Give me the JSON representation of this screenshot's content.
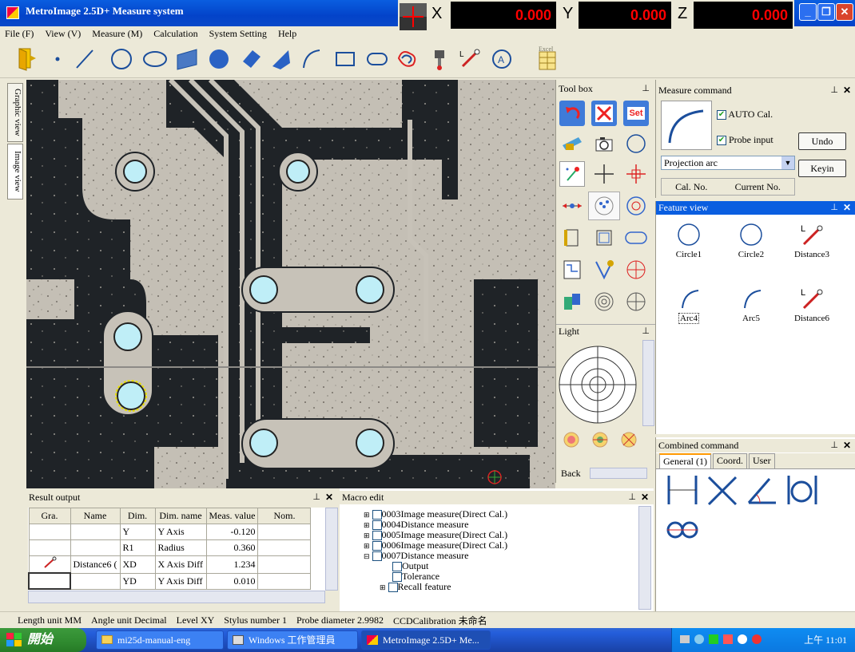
{
  "window": {
    "title": "MetroImage 2.5D+ Measure system"
  },
  "menu": [
    "File (F)",
    "View (V)",
    "Measure (M)",
    "Calculation",
    "System Setting",
    "Help"
  ],
  "coords": {
    "x_label": "X",
    "y_label": "Y",
    "z_label": "Z",
    "x_value": "0.000",
    "y_value": "0.000",
    "z_value": "0.000"
  },
  "toolbar_icons": [
    "exit-icon",
    "point-icon",
    "line-icon",
    "circle-icon",
    "ellipse-icon",
    "plane-icon",
    "sphere-icon",
    "cylinder-icon",
    "cone-icon",
    "arc-icon",
    "rectangle-icon",
    "slot-icon",
    "curve-icon",
    "probe-icon",
    "distance-icon",
    "angle-icon",
    "excel-icon"
  ],
  "toolbar": {
    "excel_label": "Excel"
  },
  "left_tabs": [
    "Graphic view",
    "Image view"
  ],
  "toolbox": {
    "title": "Tool box",
    "set_label": "Set"
  },
  "light": {
    "title": "Light",
    "back_label": "Back"
  },
  "measure_command": {
    "title": "Measure command",
    "auto_cal": "AUTO Cal.",
    "probe_input": "Probe input",
    "undo": "Undo",
    "keyin": "Keyin",
    "select_value": "Projection arc",
    "col_cal_no": "Cal. No.",
    "col_current_no": "Current No."
  },
  "feature_view": {
    "title": "Feature view",
    "items": [
      {
        "name": "Circle1",
        "icon": "circle-icon"
      },
      {
        "name": "Circle2",
        "icon": "circle-icon"
      },
      {
        "name": "Distance3",
        "icon": "distance-icon"
      },
      {
        "name": "Arc4",
        "icon": "arc-icon"
      },
      {
        "name": "Arc5",
        "icon": "arc-icon"
      },
      {
        "name": "Distance6",
        "icon": "distance-icon"
      }
    ]
  },
  "combined_command": {
    "title": "Combined command",
    "tabs": [
      "General (1)",
      "Coord.",
      "User"
    ]
  },
  "result_output": {
    "title": "Result output",
    "columns": [
      "Gra.",
      "Name",
      "Dim.",
      "Dim. name",
      "Meas. value",
      "Nom."
    ],
    "rows": [
      [
        "",
        "",
        "Y",
        "Y Axis",
        "-0.120",
        ""
      ],
      [
        "",
        "",
        "R1",
        "Radius",
        "0.360",
        ""
      ],
      [
        "distance-icon",
        "Distance6 (",
        "XD",
        "X Axis Diff",
        "1.234",
        ""
      ],
      [
        "",
        "",
        "YD",
        "Y Axis Diff",
        "0.010",
        ""
      ]
    ]
  },
  "macro_edit": {
    "title": "Macro edit",
    "items": [
      {
        "label": "0003Image measure(Direct Cal.)",
        "level": 0,
        "expander": "+"
      },
      {
        "label": "0004Distance measure",
        "level": 0,
        "expander": "+"
      },
      {
        "label": "0005Image measure(Direct Cal.)",
        "level": 0,
        "expander": "+"
      },
      {
        "label": "0006Image measure(Direct Cal.)",
        "level": 0,
        "expander": "+"
      },
      {
        "label": "0007Distance measure",
        "level": 0,
        "expander": "-"
      },
      {
        "label": "Output",
        "level": 1,
        "expander": ""
      },
      {
        "label": "Tolerance",
        "level": 1,
        "expander": ""
      },
      {
        "label": "Recall feature",
        "level": 1,
        "expander": "+"
      }
    ]
  },
  "status": [
    "Length unit  MM",
    "Angle unit  Decimal",
    "Level  XY",
    "Stylus number  1",
    "Probe diameter  2.9982",
    "CCDCalibration  未命名"
  ],
  "taskbar": {
    "start": "開始",
    "tasks": [
      "mi25d-manual-eng",
      "Windows 工作管理員",
      "MetroImage 2.5D+ Me..."
    ],
    "clock": "上午 11:01"
  },
  "colors": {
    "title_blue": "#0a5ee0",
    "coord_red": "#ff0000",
    "pcb_dark": "#1e2228",
    "pad_cyan": "#bfeef7"
  }
}
